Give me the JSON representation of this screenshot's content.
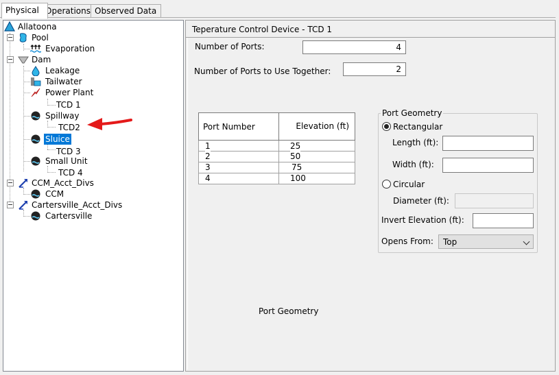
{
  "tabs": [
    {
      "label": "Physical",
      "underline": "P",
      "rest": "hysical",
      "active": true
    },
    {
      "label": "Operations",
      "underline": "O",
      "rest": "perations",
      "active": false
    },
    {
      "label": "Observed Data",
      "underline": "b",
      "pre": "O",
      "rest": "served Data",
      "active": false
    }
  ],
  "tree": {
    "allatoona": "Allatoona",
    "pool": "Pool",
    "evaporation": "Evaporation",
    "dam": "Dam",
    "leakage": "Leakage",
    "tailwater": "Tailwater",
    "power_plant": "Power Plant",
    "tcd1": "TCD 1",
    "spillway": "Spillway",
    "tcd2": "TCD2",
    "sluice": "Sluice",
    "tcd3": "TCD 3",
    "small_unit": "Small Unit",
    "tcd4": "TCD 4",
    "ccm_acct_divs": "CCM_Acct_Divs",
    "ccm": "CCM",
    "cartersville_acct_divs": "Cartersville_Acct_Divs",
    "cartersville": "Cartersville"
  },
  "panel": {
    "title": "Teperature Control Device - TCD 1",
    "num_ports_label": "Number of Ports:",
    "num_ports_value": "4",
    "num_ports_together_label": "Number of Ports to Use Together:",
    "num_ports_together_value": "2",
    "table": {
      "headers": [
        "Port Number",
        "Elevation (ft)"
      ],
      "rows": [
        [
          "1",
          "25"
        ],
        [
          "2",
          "50"
        ],
        [
          "3",
          "75"
        ],
        [
          "4",
          "100"
        ]
      ]
    },
    "geometry": {
      "title": "Port Geometry",
      "rectangular": "Rectangular",
      "length_label": "Length (ft):",
      "width_label": "Width (ft):",
      "circular": "Circular",
      "diameter_label": "Diameter (ft):",
      "invert_label": "Invert Elevation (ft):",
      "opens_from_label": "Opens From:",
      "opens_from_value": "Top"
    },
    "port_geometry_caption": "Port Geometry"
  },
  "colors": {
    "selection": "#0078d7",
    "annotation_arrow": "#e41a1a"
  }
}
